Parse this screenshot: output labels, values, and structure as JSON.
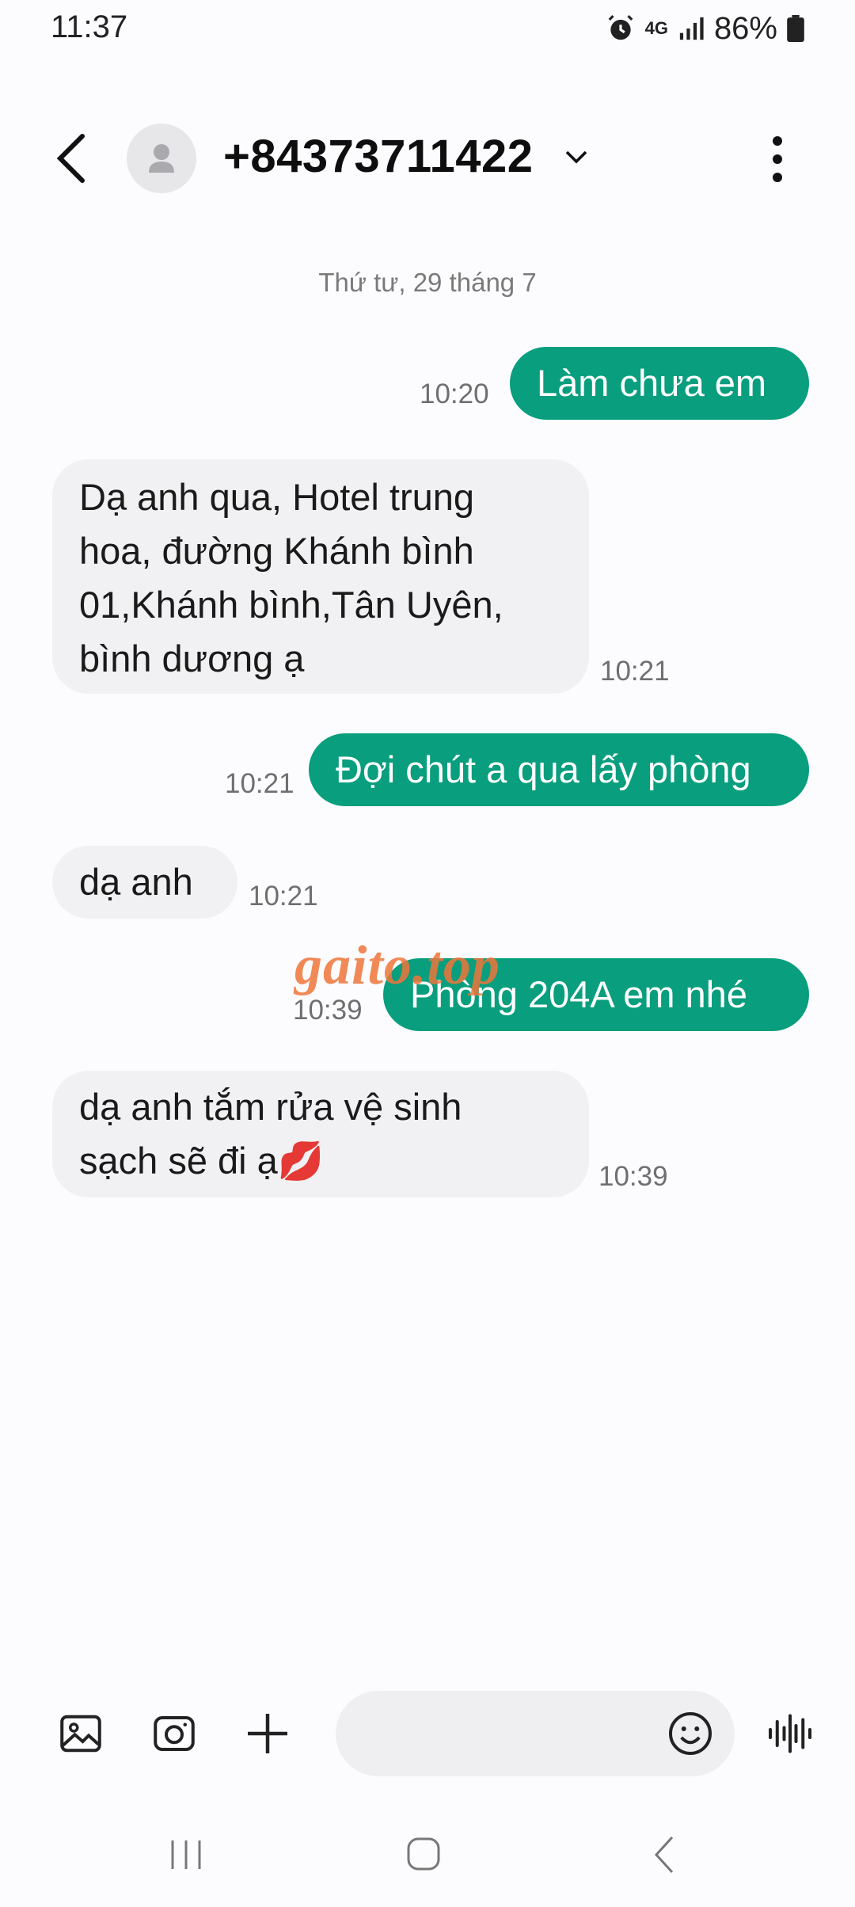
{
  "status_bar": {
    "time": "11:37",
    "network": "4G",
    "battery": "86%"
  },
  "header": {
    "contact": "+84373711422"
  },
  "conversation": {
    "date_separator": "Thứ tư, 29 tháng 7",
    "messages": [
      {
        "direction": "outgoing",
        "text": "Làm chưa em",
        "time": "10:20"
      },
      {
        "direction": "incoming",
        "lines": [
          "Dạ anh qua, Hotel trung",
          "hoa, đường Khánh bình",
          "01,Khánh bình,Tân Uyên,",
          "bình dương ạ"
        ],
        "time": "10:21"
      },
      {
        "direction": "outgoing",
        "text": "Đợi chút a qua lấy phòng",
        "time": "10:21"
      },
      {
        "direction": "incoming",
        "text": "dạ anh",
        "time": "10:21"
      },
      {
        "direction": "outgoing",
        "text": "Phòng 204A em nhé",
        "time": "10:39"
      },
      {
        "direction": "incoming",
        "lines": [
          "dạ anh tắm rửa vệ sinh",
          "sạch sẽ đi ạ💋"
        ],
        "time": "10:39"
      }
    ]
  },
  "watermark": "gaito.top",
  "colors": {
    "outgoing_bubble": "#089e7e",
    "incoming_bubble": "#f1f1f3",
    "background": "#fcfcff"
  },
  "icons": {
    "back": "chevron-left-icon",
    "more": "more-vertical-icon",
    "gallery": "image-icon",
    "camera": "camera-icon",
    "attach": "plus-icon",
    "emoji": "emoji-icon",
    "voice": "voice-wave-icon"
  }
}
